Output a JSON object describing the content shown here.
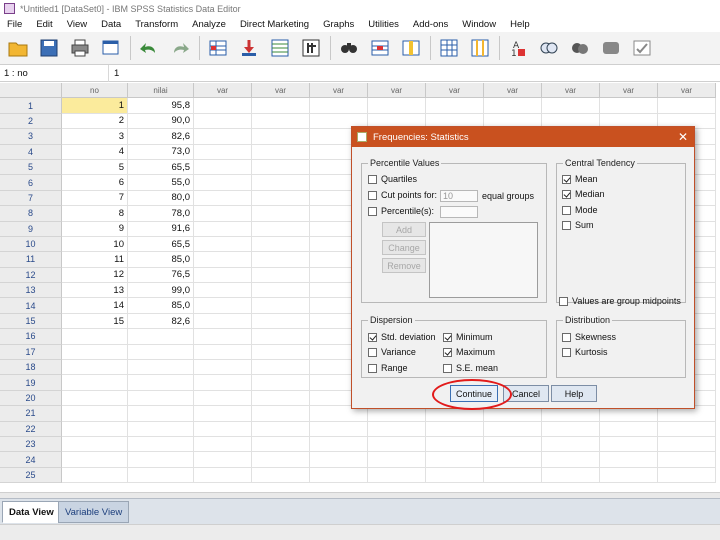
{
  "window": {
    "title": "*Untitled1 [DataSet0] - IBM SPSS Statistics Data Editor"
  },
  "menu": [
    "File",
    "Edit",
    "View",
    "Data",
    "Transform",
    "Analyze",
    "Direct Marketing",
    "Graphs",
    "Utilities",
    "Add-ons",
    "Window",
    "Help"
  ],
  "toolbar_icons": [
    "open-folder-icon",
    "save-icon",
    "print-icon",
    "dialog-recall-icon",
    "undo-icon",
    "redo-icon",
    "goto-case-icon",
    "goto-variable-icon",
    "variables-icon",
    "run-descriptives-icon",
    "find-icon",
    "insert-cases-icon",
    "insert-variable-icon",
    "split-file-icon",
    "weight-cases-icon",
    "select-cases-icon",
    "value-labels-icon",
    "use-variable-sets-icon",
    "show-all-variables-icon",
    "spelling-icon"
  ],
  "cell_reference": {
    "ref": "1 : no",
    "value": "1"
  },
  "grid": {
    "columns": [
      "no",
      "nilai",
      "var",
      "var",
      "var",
      "var",
      "var",
      "var",
      "var",
      "var",
      "var"
    ],
    "rows": [
      {
        "num": "1",
        "no": "1",
        "nilai": "95,8"
      },
      {
        "num": "2",
        "no": "2",
        "nilai": "90,0"
      },
      {
        "num": "3",
        "no": "3",
        "nilai": "82,6"
      },
      {
        "num": "4",
        "no": "4",
        "nilai": "73,0"
      },
      {
        "num": "5",
        "no": "5",
        "nilai": "65,5"
      },
      {
        "num": "6",
        "no": "6",
        "nilai": "55,0"
      },
      {
        "num": "7",
        "no": "7",
        "nilai": "80,0"
      },
      {
        "num": "8",
        "no": "8",
        "nilai": "78,0"
      },
      {
        "num": "9",
        "no": "9",
        "nilai": "91,6"
      },
      {
        "num": "10",
        "no": "10",
        "nilai": "65,5"
      },
      {
        "num": "11",
        "no": "11",
        "nilai": "85,0"
      },
      {
        "num": "12",
        "no": "12",
        "nilai": "76,5"
      },
      {
        "num": "13",
        "no": "13",
        "nilai": "99,0"
      },
      {
        "num": "14",
        "no": "14",
        "nilai": "85,0"
      },
      {
        "num": "15",
        "no": "15",
        "nilai": "82,6"
      },
      {
        "num": "16",
        "no": "",
        "nilai": ""
      },
      {
        "num": "17",
        "no": "",
        "nilai": ""
      },
      {
        "num": "18",
        "no": "",
        "nilai": ""
      },
      {
        "num": "19",
        "no": "",
        "nilai": ""
      },
      {
        "num": "20",
        "no": "",
        "nilai": ""
      },
      {
        "num": "21",
        "no": "",
        "nilai": ""
      },
      {
        "num": "22",
        "no": "",
        "nilai": ""
      },
      {
        "num": "23",
        "no": "",
        "nilai": ""
      },
      {
        "num": "24",
        "no": "",
        "nilai": ""
      },
      {
        "num": "25",
        "no": "",
        "nilai": ""
      }
    ]
  },
  "tabs": {
    "data_view": "Data View",
    "variable_view": "Variable View"
  },
  "dialog": {
    "title": "Frequencies: Statistics",
    "percentile_values": {
      "legend": "Percentile Values",
      "quartiles": {
        "label": "Quartiles",
        "checked": false
      },
      "cut_points": {
        "label": "Cut points for:",
        "value": "10",
        "suffix": "equal groups",
        "checked": false
      },
      "percentiles": {
        "label": "Percentile(s):",
        "checked": false
      },
      "add": "Add",
      "change": "Change",
      "remove": "Remove"
    },
    "central_tendency": {
      "legend": "Central Tendency",
      "mean": {
        "label": "Mean",
        "checked": true
      },
      "median": {
        "label": "Median",
        "checked": true
      },
      "mode": {
        "label": "Mode",
        "checked": false
      },
      "sum": {
        "label": "Sum",
        "checked": false
      }
    },
    "group_midpoints": {
      "label": "Values are group midpoints",
      "checked": false
    },
    "dispersion": {
      "legend": "Dispersion",
      "std_deviation": {
        "label": "Std. deviation",
        "checked": true
      },
      "minimum": {
        "label": "Minimum",
        "checked": true
      },
      "variance": {
        "label": "Variance",
        "checked": false
      },
      "maximum": {
        "label": "Maximum",
        "checked": true
      },
      "range": {
        "label": "Range",
        "checked": false
      },
      "se_mean": {
        "label": "S.E. mean",
        "checked": false
      }
    },
    "distribution": {
      "legend": "Distribution",
      "skewness": {
        "label": "Skewness",
        "checked": false
      },
      "kurtosis": {
        "label": "Kurtosis",
        "checked": false
      }
    },
    "buttons": {
      "continue": "Continue",
      "cancel": "Cancel",
      "help": "Help"
    }
  },
  "colors": {
    "dialog_title_bar": "#c9511f",
    "highlight_ring": "#e21a1a",
    "selected_cell": "#fbeb9c"
  }
}
